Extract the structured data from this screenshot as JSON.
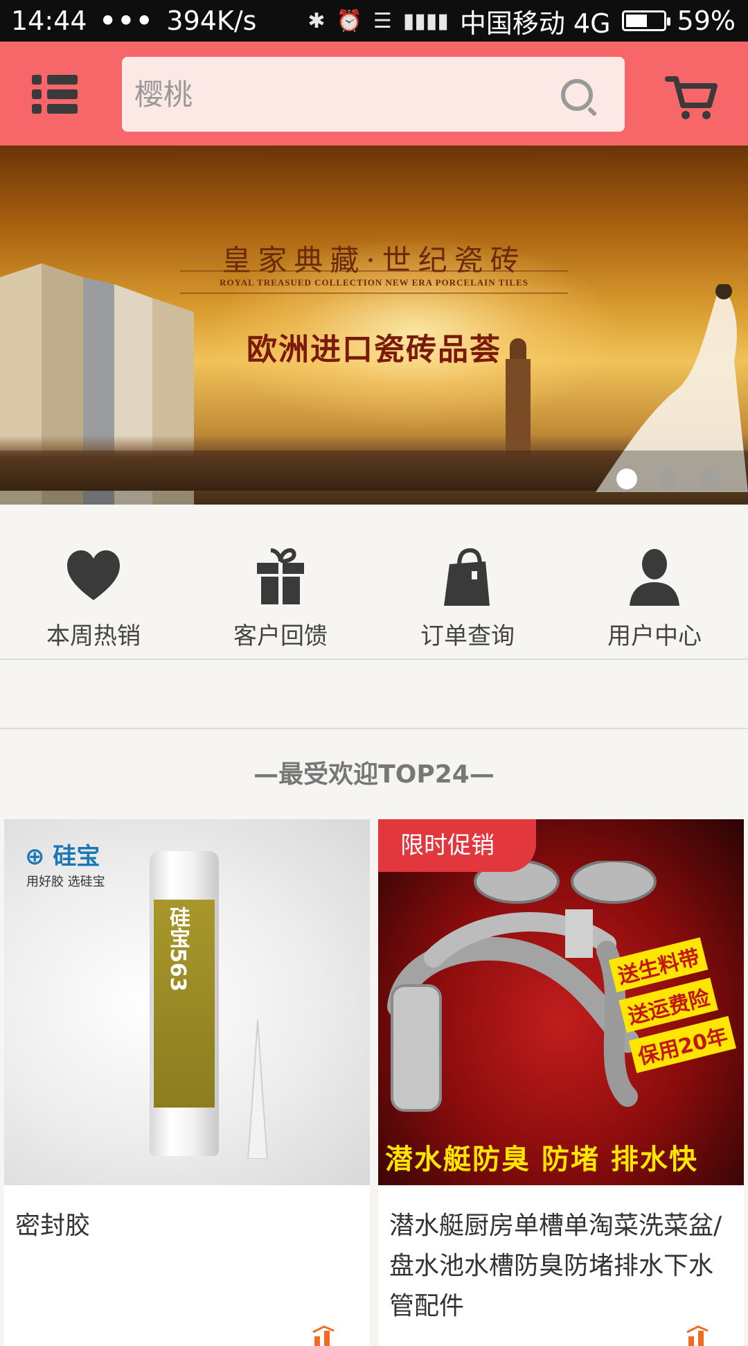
{
  "status_bar": {
    "time": "14:44",
    "dots": "•••",
    "speed": "394K/s",
    "carrier": "中国移动 4G",
    "battery": "59%",
    "battery_level": 0.59
  },
  "header": {
    "search_placeholder": "樱桃"
  },
  "banner": {
    "title": "皇家典藏·世纪瓷砖",
    "subtitle": "ROYAL TREASUED COLLECTION NEW ERA PORCELAIN TILES",
    "headline": "欧洲进口瓷砖品荟",
    "active_slide": 1,
    "slide_count": 3
  },
  "quick_nav": [
    {
      "label": "本周热销",
      "icon": "heart-icon"
    },
    {
      "label": "客户回馈",
      "icon": "gift-icon"
    },
    {
      "label": "订单查询",
      "icon": "shopping-bag-icon"
    },
    {
      "label": "用户中心",
      "icon": "user-icon"
    }
  ],
  "section": {
    "title": "—最受欢迎TOP24—"
  },
  "products": [
    {
      "name": "密封胶",
      "brand": "硅宝",
      "brand_slogan": "用好胶 选硅宝",
      "tube_text": "硅宝563"
    },
    {
      "name": "潜水艇厨房单槽单淘菜洗菜盆/盘水池水槽防臭防堵排水下水管配件",
      "promo_badge": "限时促销",
      "image_text": "潜水艇防臭 防堵 排水快",
      "image_tags": [
        "送生料带",
        "送运费险",
        "保用20年"
      ]
    }
  ],
  "colors": {
    "header": "#f7676a",
    "promo": "#e2373d",
    "icon_dark": "#3a3a3a"
  }
}
